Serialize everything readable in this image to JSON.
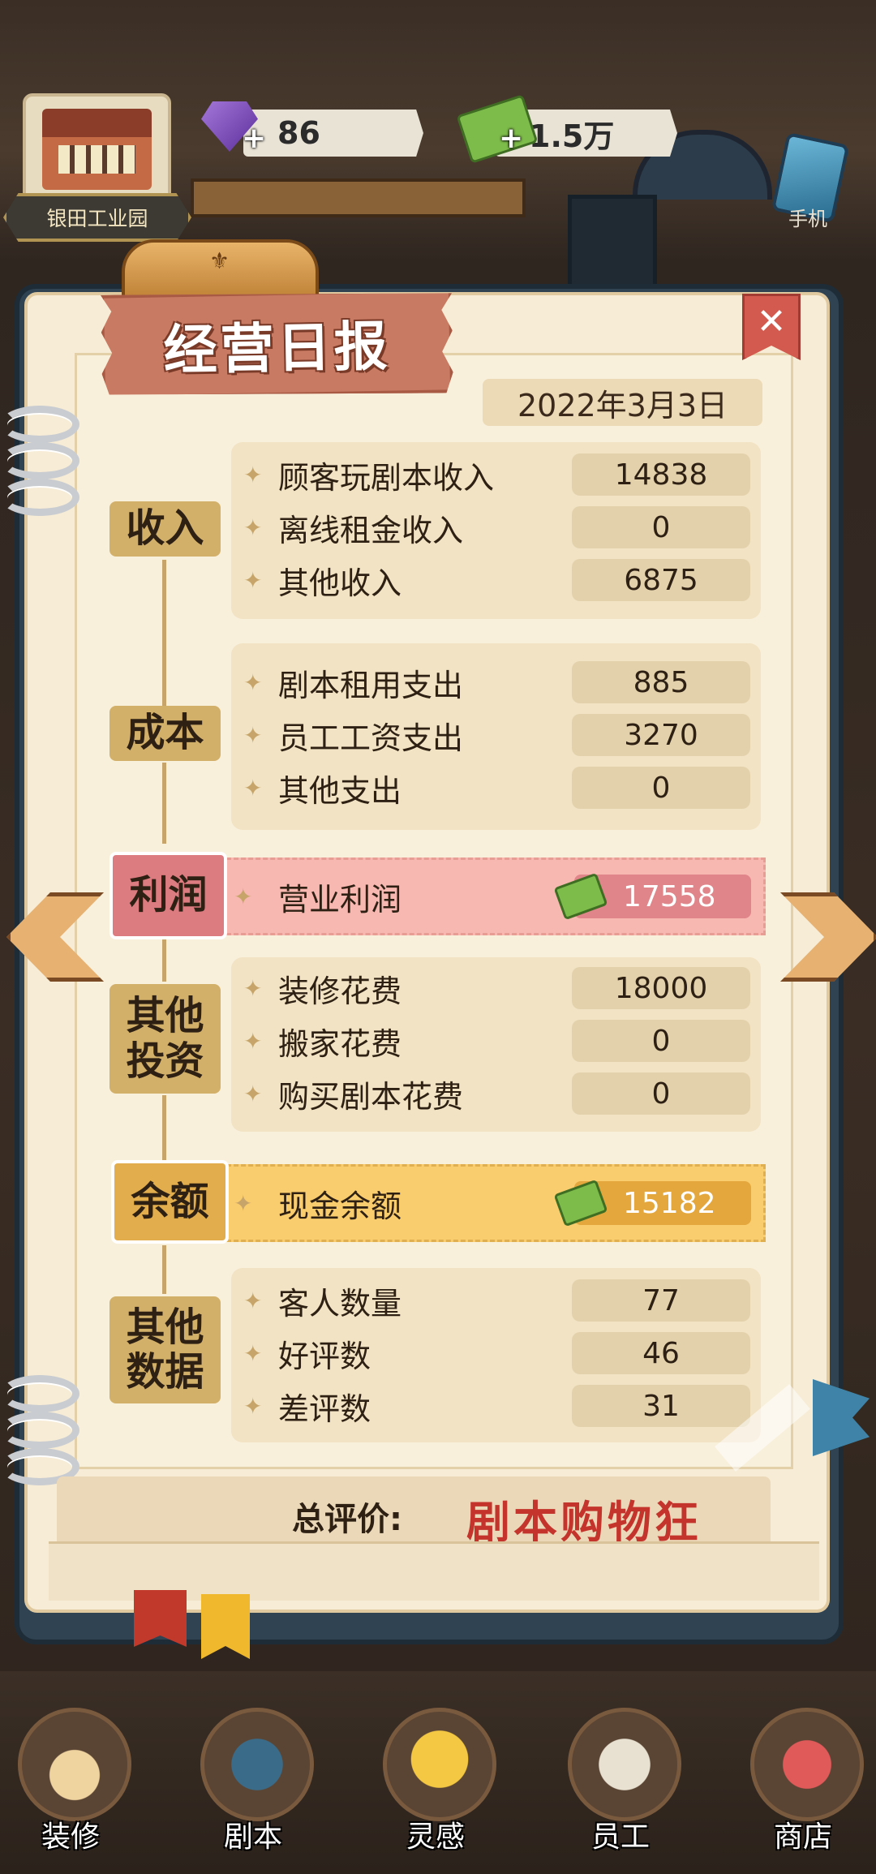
{
  "hud": {
    "venue_name": "银田工业园",
    "gems": "86",
    "cash": "1.5万",
    "plus": "+",
    "phone_label": "手机"
  },
  "report": {
    "title": "经营日报",
    "close": "✕",
    "date": "2022年3月3日",
    "sections": {
      "income": {
        "label": "收入",
        "rows": [
          {
            "label": "顾客玩剧本收入",
            "value": "14838"
          },
          {
            "label": "离线租金收入",
            "value": "0"
          },
          {
            "label": "其他收入",
            "value": "6875"
          }
        ]
      },
      "cost": {
        "label": "成本",
        "rows": [
          {
            "label": "剧本租用支出",
            "value": "885"
          },
          {
            "label": "员工工资支出",
            "value": "3270"
          },
          {
            "label": "其他支出",
            "value": "0"
          }
        ]
      },
      "profit": {
        "label": "利润",
        "row_label": "营业利润",
        "value": "17558"
      },
      "invest": {
        "label_line1": "其他",
        "label_line2": "投资",
        "rows": [
          {
            "label": "装修花费",
            "value": "18000"
          },
          {
            "label": "搬家花费",
            "value": "0"
          },
          {
            "label": "购买剧本花费",
            "value": "0"
          }
        ]
      },
      "balance": {
        "label": "余额",
        "row_label": "现金余额",
        "value": "15182"
      },
      "other": {
        "label_line1": "其他",
        "label_line2": "数据",
        "rows": [
          {
            "label": "客人数量",
            "value": "77"
          },
          {
            "label": "好评数",
            "value": "46"
          },
          {
            "label": "差评数",
            "value": "31"
          }
        ]
      }
    },
    "rating_label": "总评价:",
    "rating_value": "剧本购物狂",
    "star_glyph": "✦"
  },
  "nav": {
    "items": [
      {
        "label": "装修",
        "icon": "house-icon"
      },
      {
        "label": "剧本",
        "icon": "book-icon"
      },
      {
        "label": "灵感",
        "icon": "lightbulb-icon"
      },
      {
        "label": "员工",
        "icon": "badge-icon"
      },
      {
        "label": "商店",
        "icon": "shop-icon"
      }
    ]
  },
  "colors": {
    "profit_bg": "#f8b8b2",
    "balance_bg": "#f9cc6e",
    "category_bg": "#d3b06a",
    "rating_red": "#c4342c",
    "title_banner": "#c97a63"
  }
}
